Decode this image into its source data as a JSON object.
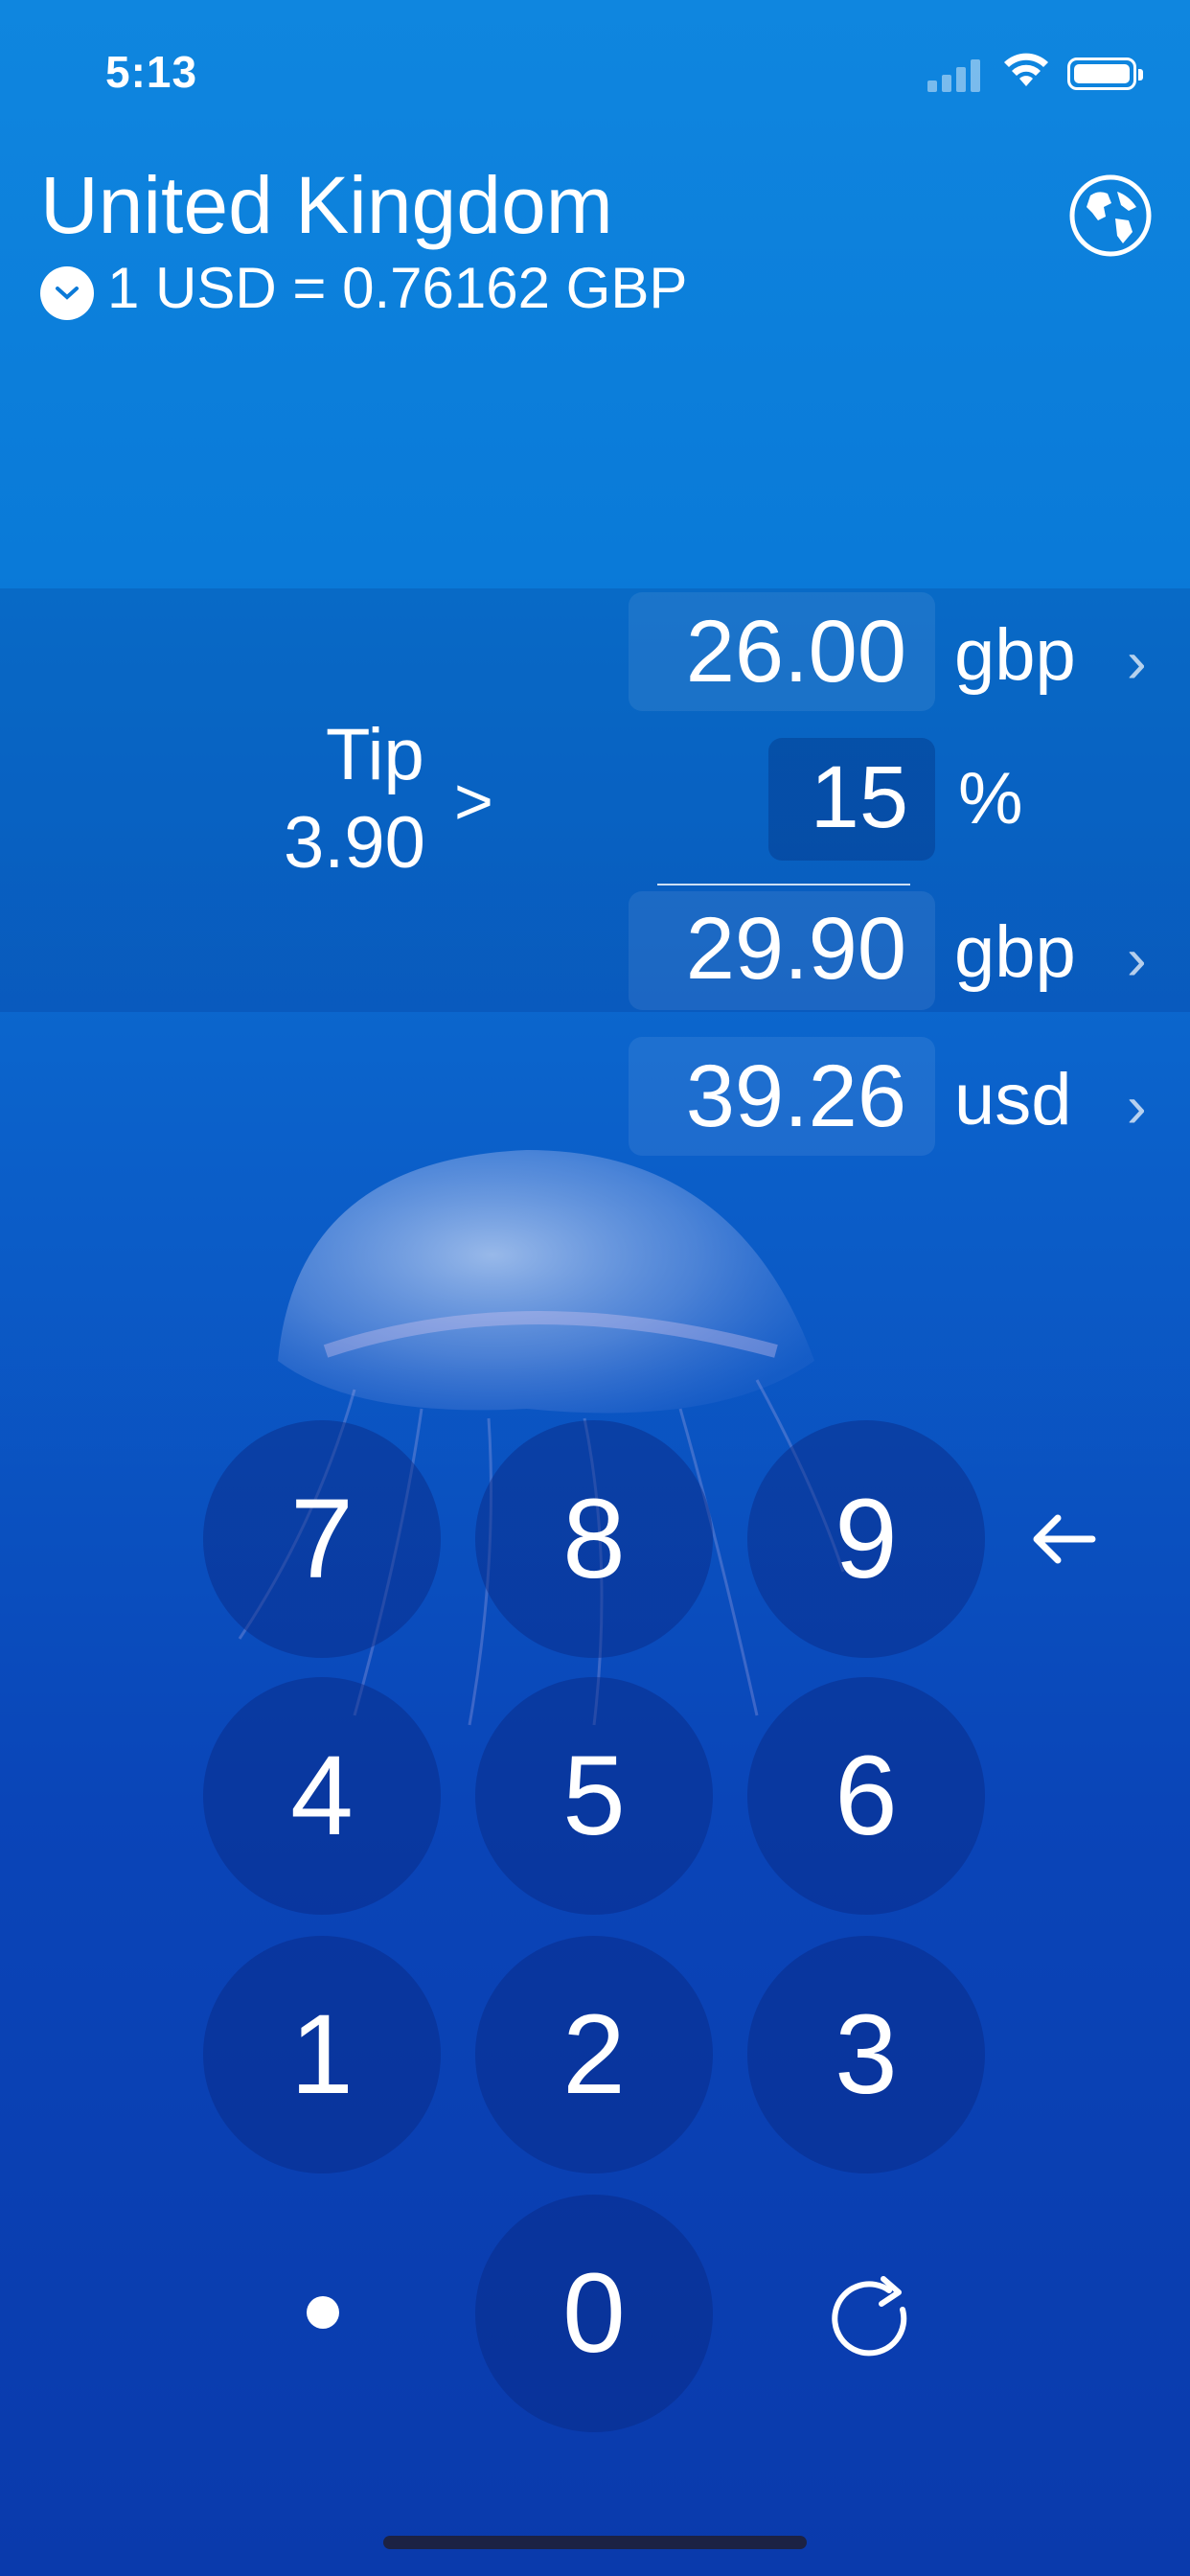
{
  "status_bar": {
    "time": "5:13"
  },
  "header": {
    "country": "United Kingdom",
    "rate_text": "1 USD = 0.76162 GBP",
    "globe_icon": "globe-icon",
    "rate_toggle_icon": "chevron-down-circle-icon"
  },
  "calculator": {
    "bill_amount": "26.00",
    "bill_currency": "gbp",
    "tip_label": "Tip",
    "tip_value": "3.90",
    "tip_arrow": ">",
    "tip_percent": "15",
    "percent_symbol": "%",
    "total_amount": "29.90",
    "total_currency": "gbp",
    "converted_amount": "39.26",
    "converted_currency": "usd"
  },
  "keypad": {
    "keys": [
      "7",
      "8",
      "9",
      "4",
      "5",
      "6",
      "1",
      "2",
      "3",
      "0"
    ],
    "backspace_icon": "arrow-left-icon",
    "decimal_icon": "dot-icon",
    "reset_icon": "refresh-icon"
  },
  "colors": {
    "background_top": "#0f86df",
    "background_bottom": "#0a3aac",
    "key_fill": "#08288266"
  }
}
